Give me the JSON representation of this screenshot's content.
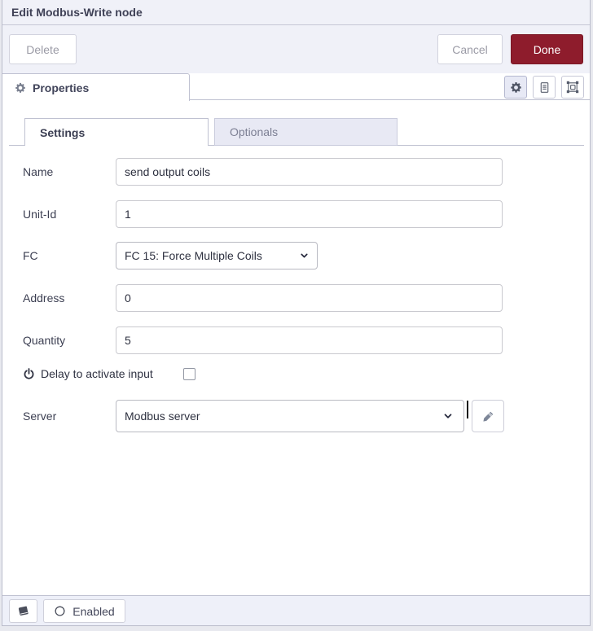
{
  "title_bar": {
    "title": "Edit Modbus-Write node"
  },
  "toolbar": {
    "delete": "Delete",
    "cancel": "Cancel",
    "done": "Done"
  },
  "tab_bar": {
    "properties": "Properties",
    "icons": [
      "gear-icon",
      "document-icon",
      "appearance-icon"
    ]
  },
  "subtabs": {
    "settings": "Settings",
    "optionals": "Optionals"
  },
  "form": {
    "name_label": "Name",
    "name_value": "send output coils",
    "unit_label": "Unit-Id",
    "unit_value": "1",
    "fc_label": "FC",
    "fc_value": "FC 15: Force Multiple Coils",
    "address_label": "Address",
    "address_value": "0",
    "quantity_label": "Quantity",
    "quantity_value": "5",
    "delay_label": "Delay to activate input",
    "delay_checked": false,
    "server_label": "Server",
    "server_value": "Modbus server"
  },
  "footer": {
    "enabled": "Enabled"
  },
  "colors": {
    "accent_red": "#8e1c2c",
    "panel_bg": "#f0f1f8",
    "inactive_tab_bg": "#e8e9f4",
    "footer_bg": "#eef0f9",
    "border": "#bfc1d1"
  }
}
